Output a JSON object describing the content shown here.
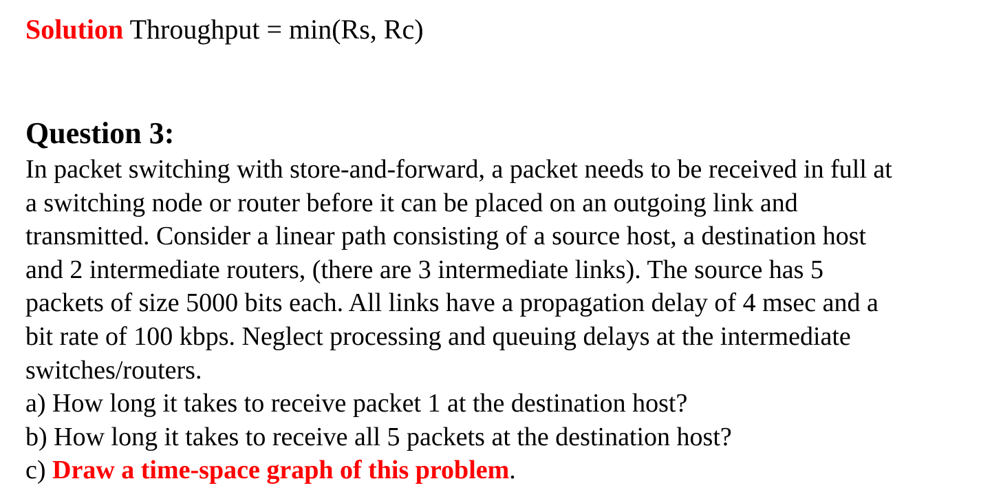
{
  "solution": {
    "label": "Solution",
    "formula": "Throughput = min(Rs, Rc)"
  },
  "question": {
    "heading": "Question 3:",
    "body_lines": [
      "In packet switching with store-and-forward, a packet needs to be received in full at",
      "a switching node or router before it can be placed on an outgoing link and",
      "transmitted. Consider a linear path consisting of a source host, a destination host",
      "and 2 intermediate routers, (there are 3 intermediate links). The source has 5",
      "packets of size 5000 bits each. All links have a propagation delay of 4 msec and a",
      "bit rate of 100 kbps. Neglect processing and queuing delays at the intermediate",
      "switches/routers."
    ],
    "parts": {
      "a": "a) How long it takes to receive packet 1 at the destination host?",
      "b": "b) How long it takes to receive all 5 packets at the destination host?",
      "c_prefix": "c) ",
      "c_emphasis": "Draw a time-space graph of this problem",
      "c_suffix": "."
    }
  },
  "colors": {
    "accent_red": "#ff0000",
    "text": "#000000",
    "background": "#ffffff"
  }
}
